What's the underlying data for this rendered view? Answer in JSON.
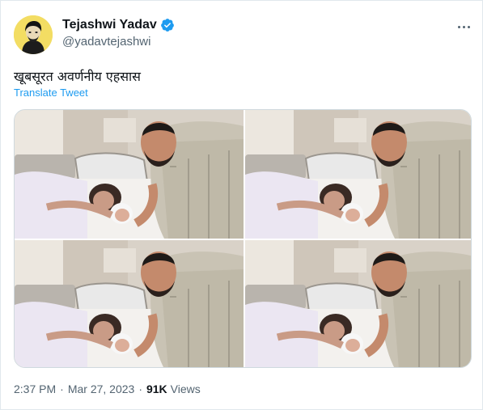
{
  "author": {
    "name": "Tejashwi Yadav",
    "handle": "@yadavtejashwi",
    "verified": true,
    "avatar_icon": "profile-photo",
    "verified_icon": "verified-badge-icon",
    "verified_color": "#1d9bf0"
  },
  "menu": {
    "icon": "more-options-icon"
  },
  "tweet": {
    "text": "खूबसूरत अवर्णनीय एहसास",
    "translate_label": "Translate Tweet"
  },
  "media": {
    "count": 4,
    "photos": [
      {
        "description_icon": "photo-newborn"
      },
      {
        "description_icon": "photo-newborn"
      },
      {
        "description_icon": "photo-newborn"
      },
      {
        "description_icon": "photo-newborn"
      }
    ]
  },
  "meta": {
    "time": "2:37 PM",
    "separator": "·",
    "date": "Mar 27, 2023",
    "views_count": "91K",
    "views_label": "Views"
  },
  "colors": {
    "text": "#0f1419",
    "secondary": "#536471",
    "link": "#1d9bf0",
    "border": "#cfd9de"
  }
}
